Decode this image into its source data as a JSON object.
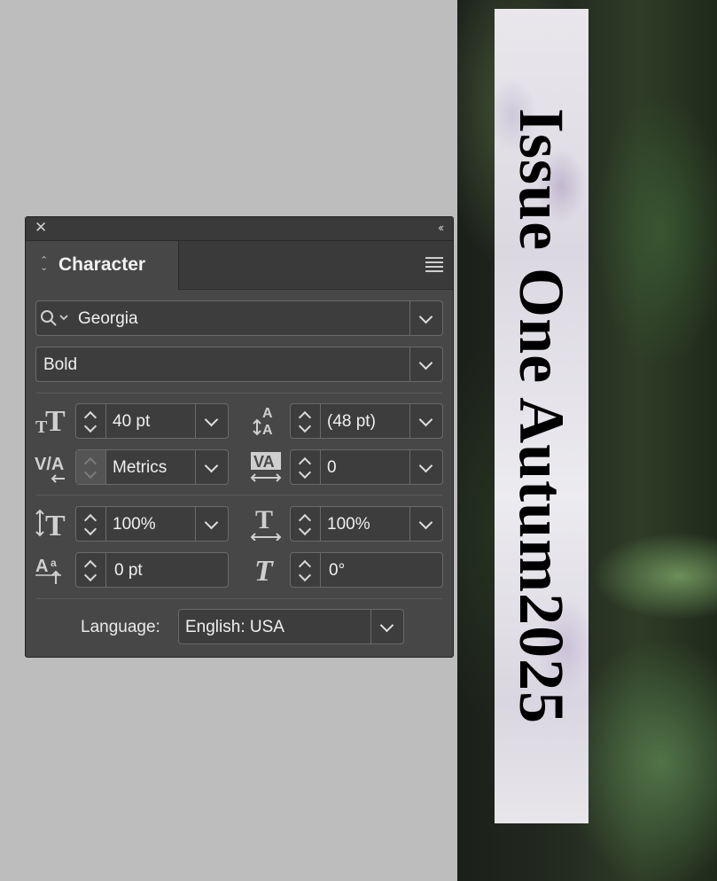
{
  "panel": {
    "title": "Character",
    "font_family": "Georgia",
    "font_style": "Bold",
    "font_size": "40 pt",
    "leading": "(48 pt)",
    "kerning": "Metrics",
    "tracking": "0",
    "vertical_scale": "100%",
    "horizontal_scale": "100%",
    "baseline_shift": "0 pt",
    "skew": "0°",
    "language_label": "Language:",
    "language_value": "English: USA"
  },
  "canvas": {
    "spine_text": "Issue One Autum2025"
  },
  "icons": [
    "close-icon",
    "collapse-icon",
    "panel-menu-icon",
    "search-icon",
    "chevron-down-icon",
    "font-size-icon",
    "leading-icon",
    "kerning-icon",
    "tracking-icon",
    "vertical-scale-icon",
    "horizontal-scale-icon",
    "baseline-shift-icon",
    "skew-icon"
  ]
}
